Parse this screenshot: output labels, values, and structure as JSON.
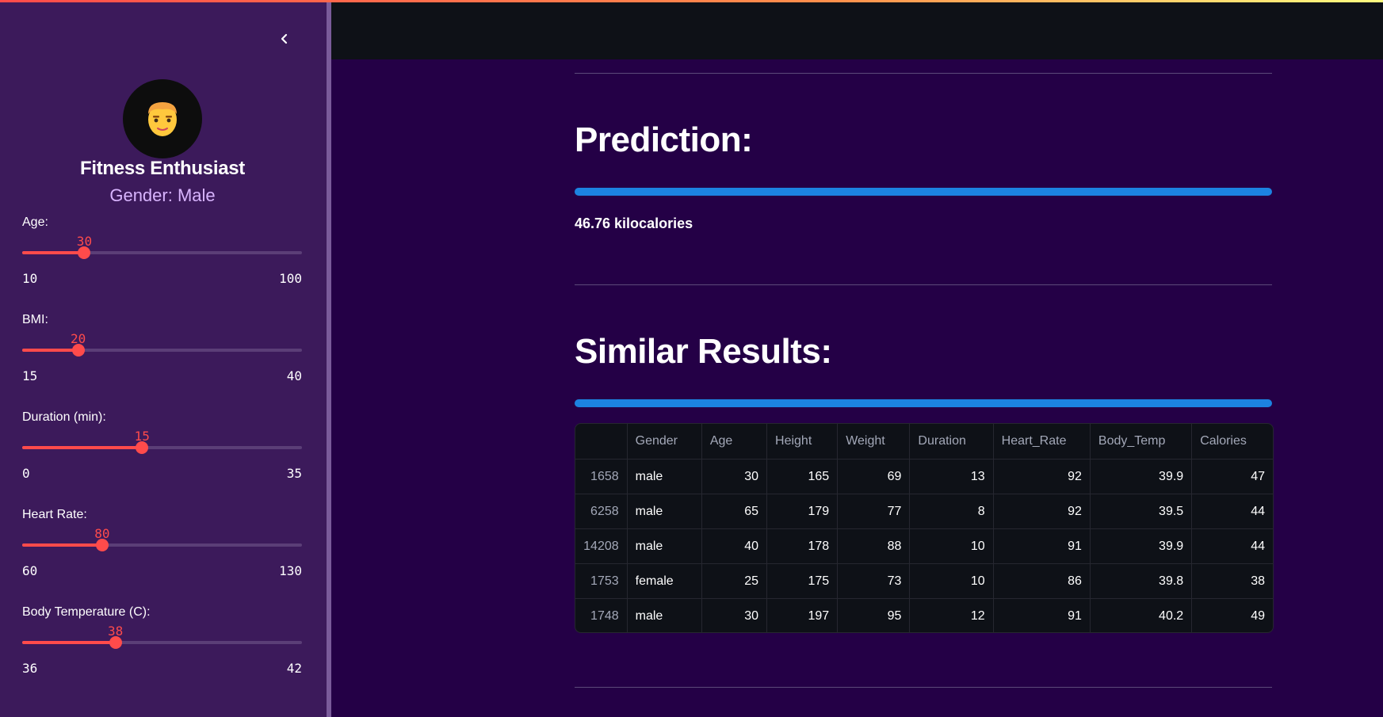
{
  "sidebar": {
    "avatar_icon": "man-face-emoji-icon",
    "profile_name": "Fitness Enthusiast",
    "profile_gender": "Gender: Male",
    "sliders": [
      {
        "label": "Age:",
        "value": "30",
        "min": "10",
        "max": "100"
      },
      {
        "label": "BMI:",
        "value": "20",
        "min": "15",
        "max": "40"
      },
      {
        "label": "Duration (min):",
        "value": "15",
        "min": "0",
        "max": "35"
      },
      {
        "label": "Heart Rate:",
        "value": "80",
        "min": "60",
        "max": "130"
      },
      {
        "label": "Body Temperature (C):",
        "value": "38",
        "min": "36",
        "max": "42"
      }
    ]
  },
  "main": {
    "prediction_title": "Prediction:",
    "prediction_progress": 1.0,
    "prediction_value": "46.76 kilocalories",
    "similar_title": "Similar Results:",
    "similar_progress": 1.0,
    "table": {
      "columns": [
        "",
        "Gender",
        "Age",
        "Height",
        "Weight",
        "Duration",
        "Heart_Rate",
        "Body_Temp",
        "Calories"
      ],
      "rows": [
        [
          "1658",
          "male",
          "30",
          "165",
          "69",
          "13",
          "92",
          "39.9",
          "47"
        ],
        [
          "6258",
          "male",
          "65",
          "179",
          "77",
          "8",
          "92",
          "39.5",
          "44"
        ],
        [
          "14208",
          "male",
          "40",
          "178",
          "88",
          "10",
          "91",
          "39.9",
          "44"
        ],
        [
          "1753",
          "female",
          "25",
          "175",
          "73",
          "10",
          "86",
          "39.8",
          "38"
        ],
        [
          "1748",
          "male",
          "30",
          "197",
          "95",
          "12",
          "91",
          "40.2",
          "49"
        ]
      ]
    }
  },
  "colors": {
    "background": "#240046",
    "sidebar": "#3c1a5b",
    "accent": "#ff4b4b",
    "progress": "#1c83e1",
    "gender_text": "#d8b4fe"
  }
}
